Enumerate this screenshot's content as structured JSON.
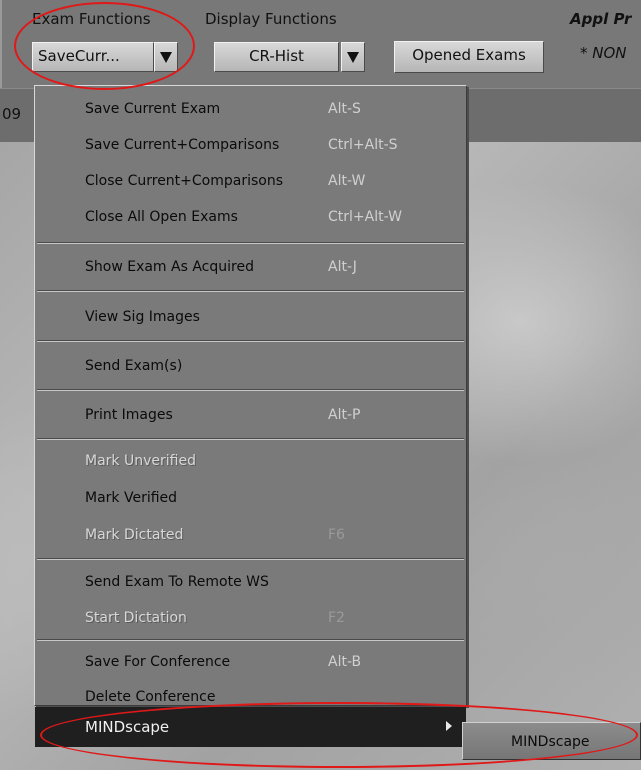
{
  "toolbar": {
    "exam_functions_label": "Exam Functions",
    "display_functions_label": "Display Functions",
    "exam_functions_value": "SaveCurr...",
    "display_functions_value": "CR-Hist",
    "opened_exams_label": "Opened Exams",
    "appl_label": "Appl Pr",
    "none_label": "* NON"
  },
  "band": {
    "partial_text": "09"
  },
  "menu": {
    "items": [
      {
        "label": "Save Current Exam",
        "shortcut": "Alt-S",
        "enabled": true
      },
      {
        "label": "Save Current+Comparisons",
        "shortcut": "Ctrl+Alt-S",
        "enabled": true
      },
      {
        "label": "Close Current+Comparisons",
        "shortcut": "Alt-W",
        "enabled": true
      },
      {
        "label": "Close All Open Exams",
        "shortcut": "Ctrl+Alt-W",
        "enabled": true
      },
      {
        "label": "Show Exam As Acquired",
        "shortcut": "Alt-J",
        "enabled": true
      },
      {
        "label": "View Sig Images",
        "shortcut": "",
        "enabled": true
      },
      {
        "label": "Send Exam(s)",
        "shortcut": "",
        "enabled": true
      },
      {
        "label": "Print Images",
        "shortcut": "Alt-P",
        "enabled": true
      },
      {
        "label": "Mark Unverified",
        "shortcut": "",
        "enabled": false
      },
      {
        "label": "Mark Verified",
        "shortcut": "",
        "enabled": true
      },
      {
        "label": "Mark Dictated",
        "shortcut": "F6",
        "enabled": false
      },
      {
        "label": "Send Exam To Remote WS",
        "shortcut": "",
        "enabled": true
      },
      {
        "label": "Start Dictation",
        "shortcut": "F2",
        "enabled": false
      },
      {
        "label": "Save For Conference",
        "shortcut": "Alt-B",
        "enabled": true
      },
      {
        "label": "Delete Conference",
        "shortcut": "",
        "enabled": true
      },
      {
        "label": "MINDscape",
        "shortcut": "",
        "enabled": true,
        "has_submenu": true
      }
    ],
    "submenu": {
      "items": [
        "MINDscape"
      ]
    }
  },
  "colors": {
    "highlight_callout": "#e01818",
    "menu_background": "#7a7a7a",
    "active_item_background": "#1f1f1f"
  }
}
